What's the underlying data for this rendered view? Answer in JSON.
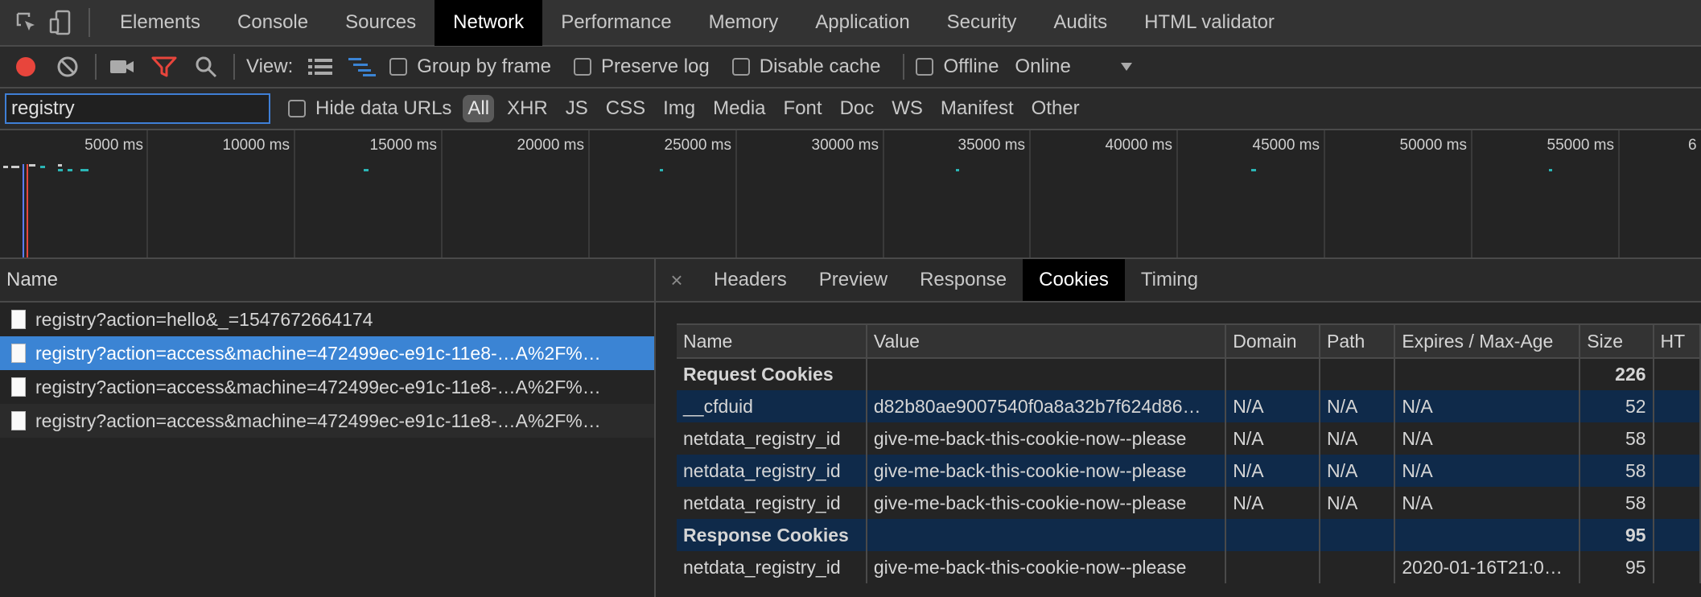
{
  "tabs": [
    "Elements",
    "Console",
    "Sources",
    "Network",
    "Performance",
    "Memory",
    "Application",
    "Security",
    "Audits",
    "HTML validator"
  ],
  "active_tab": "Network",
  "toolbar": {
    "view_label": "View:",
    "group_by_frame": "Group by frame",
    "preserve_log": "Preserve log",
    "disable_cache": "Disable cache",
    "offline": "Offline",
    "throttle_value": "Online"
  },
  "filter": {
    "value": "registry",
    "hide_data_urls": "Hide data URLs",
    "types": [
      "All",
      "XHR",
      "JS",
      "CSS",
      "Img",
      "Media",
      "Font",
      "Doc",
      "WS",
      "Manifest",
      "Other"
    ],
    "active_type": "All"
  },
  "timeline": {
    "ticks": [
      "5000 ms",
      "10000 ms",
      "15000 ms",
      "20000 ms",
      "25000 ms",
      "30000 ms",
      "35000 ms",
      "40000 ms",
      "45000 ms",
      "50000 ms",
      "55000 ms",
      "6"
    ]
  },
  "requests": {
    "header": "Name",
    "rows": [
      "registry?action=hello&_=1547672664174",
      "registry?action=access&machine=472499ec-e91c-11e8-…A%2F%…",
      "registry?action=access&machine=472499ec-e91c-11e8-…A%2F%…",
      "registry?action=access&machine=472499ec-e91c-11e8-…A%2F%…"
    ],
    "selected_index": 1
  },
  "details": {
    "close": "×",
    "tabs": [
      "Headers",
      "Preview",
      "Response",
      "Cookies",
      "Timing"
    ],
    "active_tab": "Cookies",
    "columns": [
      "Name",
      "Value",
      "Domain",
      "Path",
      "Expires / Max-Age",
      "Size",
      "HT"
    ],
    "rows": [
      {
        "kind": "group",
        "name": "Request Cookies",
        "value": "",
        "domain": "",
        "path": "",
        "expires": "",
        "size": "226",
        "highlight": false
      },
      {
        "kind": "cookie",
        "name": "__cfduid",
        "value": "d82b80ae9007540f0a8a32b7f624d86…",
        "domain": "N/A",
        "path": "N/A",
        "expires": "N/A",
        "size": "52",
        "highlight": true
      },
      {
        "kind": "cookie",
        "name": "netdata_registry_id",
        "value": "give-me-back-this-cookie-now--please",
        "domain": "N/A",
        "path": "N/A",
        "expires": "N/A",
        "size": "58",
        "highlight": false
      },
      {
        "kind": "cookie",
        "name": "netdata_registry_id",
        "value": "give-me-back-this-cookie-now--please",
        "domain": "N/A",
        "path": "N/A",
        "expires": "N/A",
        "size": "58",
        "highlight": true
      },
      {
        "kind": "cookie",
        "name": "netdata_registry_id",
        "value": "give-me-back-this-cookie-now--please",
        "domain": "N/A",
        "path": "N/A",
        "expires": "N/A",
        "size": "58",
        "highlight": false
      },
      {
        "kind": "group",
        "name": "Response Cookies",
        "value": "",
        "domain": "",
        "path": "",
        "expires": "",
        "size": "95",
        "highlight": true
      },
      {
        "kind": "cookie",
        "name": "netdata_registry_id",
        "value": "give-me-back-this-cookie-now--please",
        "domain": "",
        "path": "",
        "expires": "2020-01-16T21:0…",
        "size": "95",
        "highlight": false
      }
    ]
  },
  "colors": {
    "accent": "#3b84d4",
    "record": "#e8453c",
    "filter_icon": "#e8453c",
    "waterfall_icon": "#3b84d4",
    "timeline_mark": "#2bb5b5"
  }
}
